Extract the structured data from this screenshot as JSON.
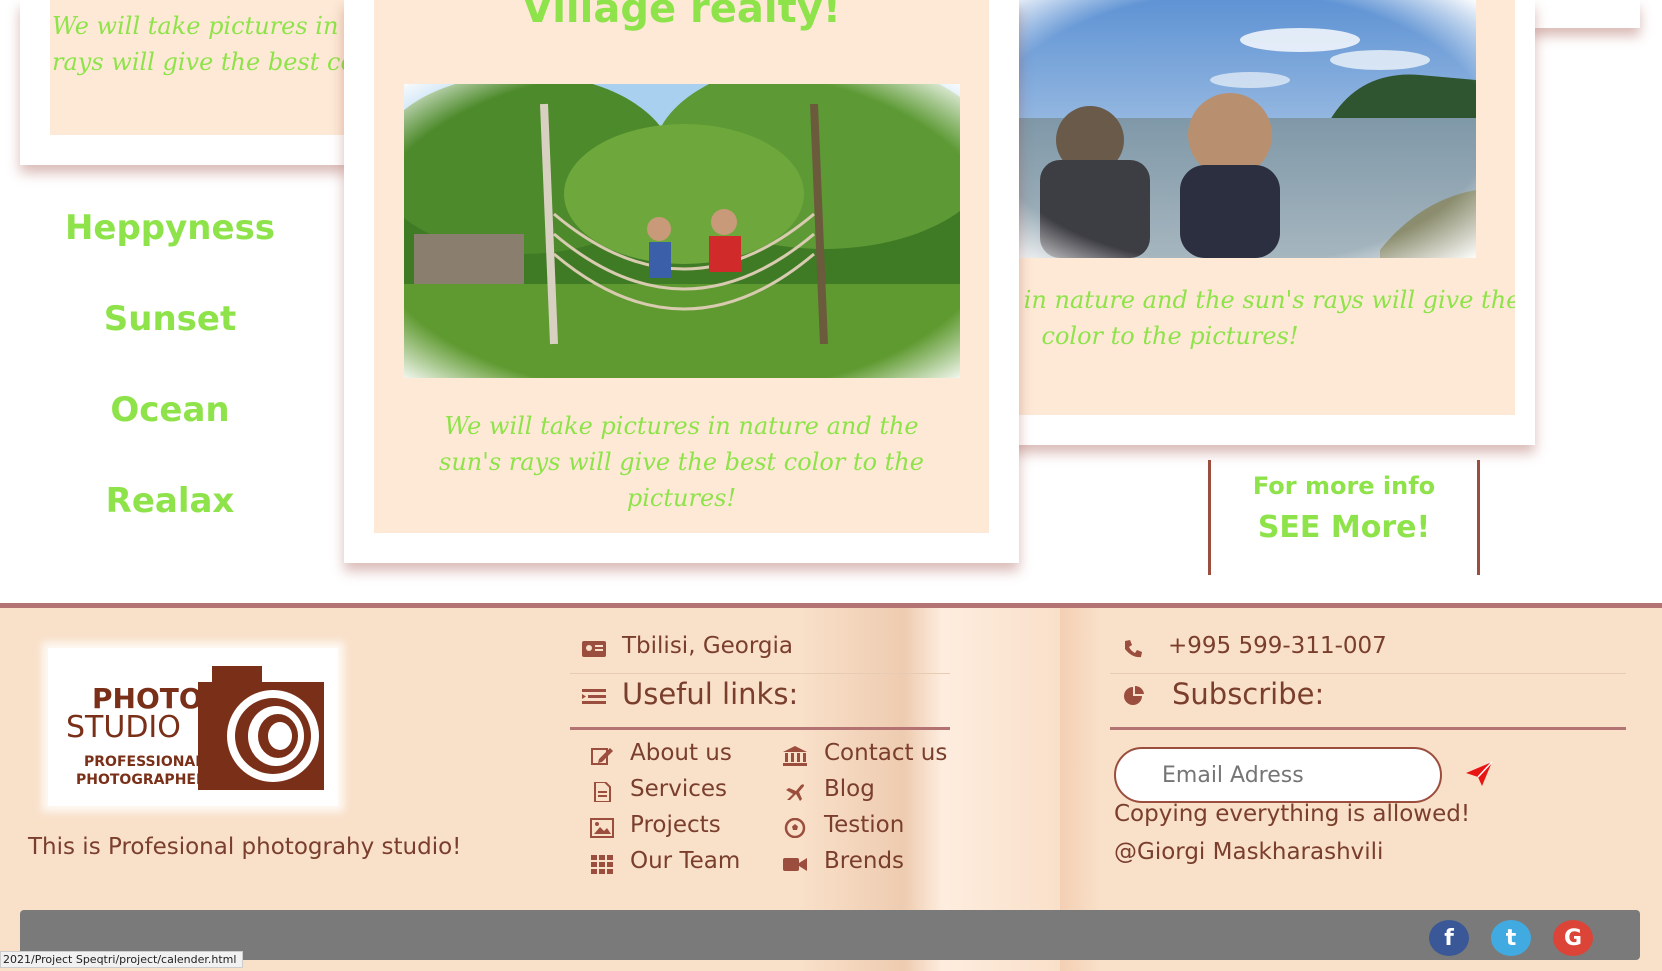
{
  "cards": {
    "left_card_text": "We will take pictures in nature and the sun's rays will give the best color to the pictures!",
    "center_title": "Village realty!",
    "center_text": "We will take pictures in nature and the sun's rays will give the best color to the pictures!",
    "right_text": "We will take pictures in nature and the sun's rays will give the best color to the pictures!"
  },
  "sidebar": {
    "items": [
      "Heppyness",
      "Sunset",
      "Ocean",
      "Realax"
    ]
  },
  "more": {
    "label": "For more info",
    "link": "SEE More!"
  },
  "footer": {
    "logo": {
      "line1": "PHOTO",
      "line2": "STUDIO",
      "line3": "PROFESSIONAL",
      "line4": "PHOTOGRAPHER"
    },
    "tagline": "This is Profesional photograhy studio!",
    "address": "Tbilisi, Georgia",
    "phone": "+995 599-311-007",
    "useful_links_title": "Useful links:",
    "subscribe_title": "Subscribe:",
    "links_left": [
      {
        "label": "About us",
        "icon": "edit-icon"
      },
      {
        "label": "Services",
        "icon": "document-icon"
      },
      {
        "label": "Projects",
        "icon": "image-icon"
      },
      {
        "label": "Our Team",
        "icon": "grid-icon"
      }
    ],
    "links_right": [
      {
        "label": "Contact us",
        "icon": "bank-icon"
      },
      {
        "label": "Blog",
        "icon": "plane-icon"
      },
      {
        "label": "Testion",
        "icon": "soccer-ball-icon"
      },
      {
        "label": "Brends",
        "icon": "video-camera-icon"
      }
    ],
    "email_placeholder": "Email Adress",
    "copy": "Copying everything is allowed!",
    "author": "@Giorgi Maskharashvili",
    "social": [
      "f",
      "t",
      "G"
    ],
    "social_icons": [
      "facebook-icon",
      "twitter-icon",
      "google-icon"
    ]
  },
  "status_bar": {
    "url": "2021/Project Speqtri/project/calender.html"
  },
  "colors": {
    "accent_green": "#8fe34a",
    "footer_bg": "#f9e0c9",
    "brown": "#7a3e2d",
    "divider": "#b27372"
  }
}
